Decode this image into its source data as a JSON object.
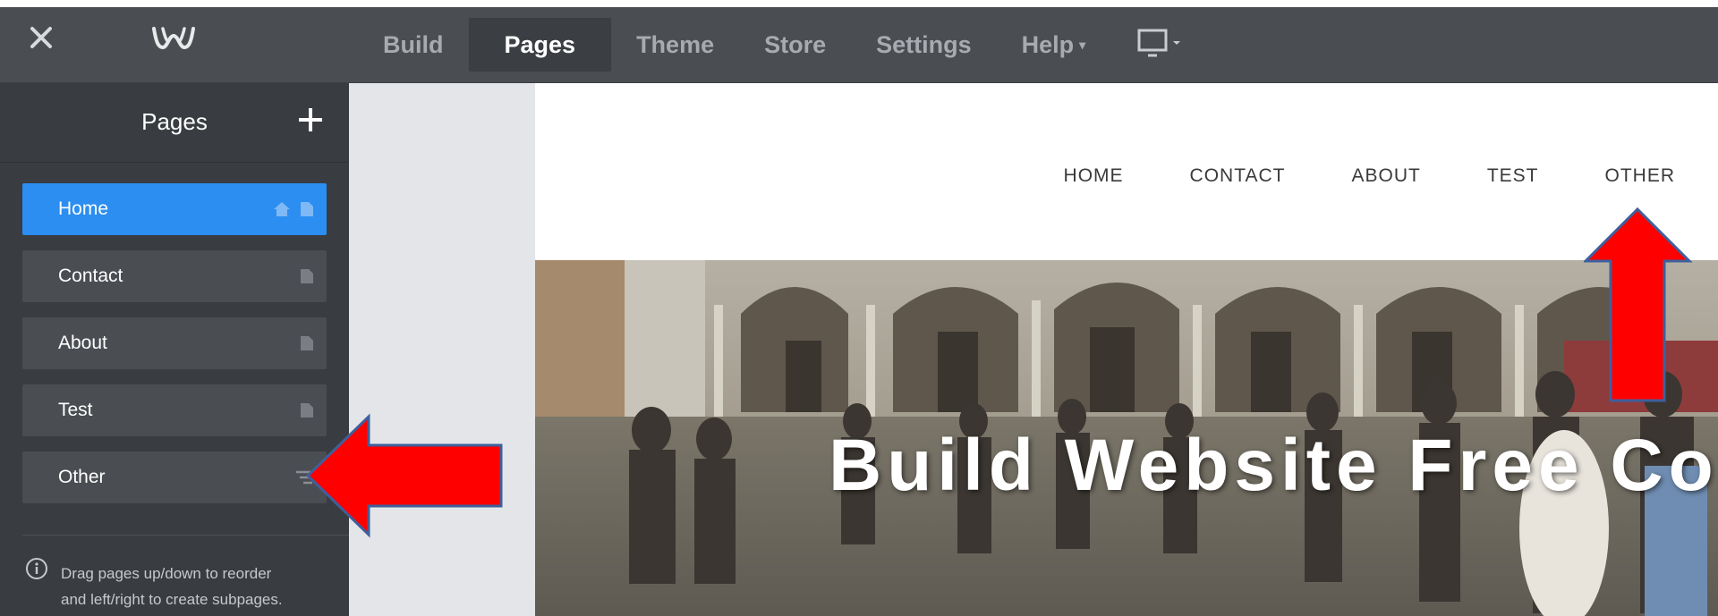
{
  "topbar": {
    "close_icon": "close-icon",
    "logo": "weebly-logo",
    "nav": [
      {
        "label": "Build",
        "active": false
      },
      {
        "label": "Pages",
        "active": true
      },
      {
        "label": "Theme",
        "active": false
      },
      {
        "label": "Store",
        "active": false
      },
      {
        "label": "Settings",
        "active": false
      },
      {
        "label": "Help",
        "active": false,
        "has_dropdown": true
      }
    ],
    "device_icon": "desktop-icon"
  },
  "sidebar": {
    "title": "Pages",
    "add_icon": "plus-icon",
    "pages": [
      {
        "label": "Home",
        "selected": true,
        "icons": [
          "home-icon",
          "page-icon"
        ]
      },
      {
        "label": "Contact",
        "selected": false,
        "icons": [
          "page-icon"
        ]
      },
      {
        "label": "About",
        "selected": false,
        "icons": [
          "page-icon"
        ]
      },
      {
        "label": "Test",
        "selected": false,
        "icons": [
          "page-icon"
        ]
      },
      {
        "label": "Other",
        "selected": false,
        "icons": [
          "menu-icon"
        ]
      }
    ],
    "hint_line1": "Drag pages up/down to reorder",
    "hint_line2": "and left/right to create subpages."
  },
  "site": {
    "nav": [
      "HOME",
      "CONTACT",
      "ABOUT",
      "TEST",
      "OTHER"
    ],
    "hero_title": "Build Website Free Co"
  },
  "colors": {
    "topbar": "#4a4d51",
    "sidebar": "#393c41",
    "selected": "#2b8ef0",
    "arrow": "#ff0000",
    "arrow_outline": "#3f5f9c"
  }
}
